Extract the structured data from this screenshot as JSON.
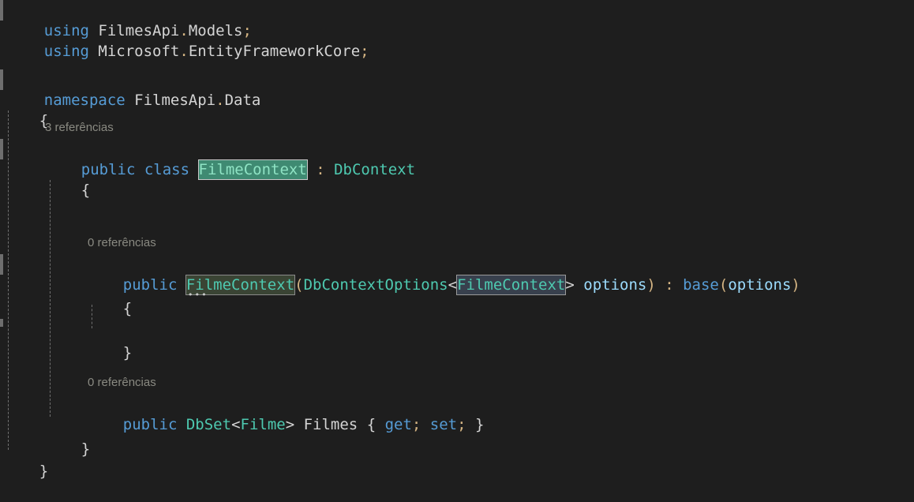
{
  "editor": {
    "background": "#1e1e1e",
    "language": "csharp",
    "font_size_px": 19,
    "line_height_px": 26
  },
  "colors": {
    "keyword": "#569cd6",
    "type": "#4ec9b0",
    "plain": "#d4d4d4",
    "variable": "#9cdcfe",
    "punctuation": "#d4b483",
    "codelens": "#8a8a82",
    "highlight_rename_bg": "#3f8a72",
    "highlight_quickaction_bg": "#3a4434",
    "highlight_occurrence_bg": "#38404d",
    "change_bar": "#6e6e6e",
    "indent_guide": "#707070"
  },
  "codelens": {
    "class_refs": "3 referências",
    "ctor_refs": "0 referências",
    "property_refs": "0 referências"
  },
  "code": {
    "line1": {
      "kw_using": "using",
      "ns": " FilmesApi",
      "dot": ".",
      "name": "Models",
      "semi": ";"
    },
    "line2": {
      "kw_using": "using",
      "ns": " Microsoft",
      "dot": ".",
      "name": "EntityFrameworkCore",
      "semi": ";"
    },
    "line4": {
      "kw_namespace": "namespace",
      "name": " FilmesApi",
      "dot": ".",
      "name2": "Data"
    },
    "line5": {
      "brace": "{"
    },
    "line7": {
      "kw_public": "public",
      "kw_class": " class",
      "space": " ",
      "classname": "FilmeContext",
      "colon": " : ",
      "base": "DbContext"
    },
    "line8": {
      "brace": "{"
    },
    "line12": {
      "kw_public": "public",
      "space": " ",
      "ctorname": "FilmeContext",
      "lparen": "(",
      "paramtype": "DbContextOptions",
      "lt": "<",
      "generic": "FilmeContext",
      "gt": ">",
      "paramname": " options",
      "rparen": ")",
      "colon": " : ",
      "kw_base": "base",
      "lparen2": "(",
      "arg": "options",
      "rparen2": ")"
    },
    "line13": {
      "brace": "{"
    },
    "line15": {
      "brace": "}"
    },
    "line18": {
      "kw_public": "public",
      "space": " ",
      "settype": "DbSet",
      "lt": "<",
      "generic": "Filme",
      "gt": ">",
      "propname": " Filmes",
      "open": " { ",
      "kw_get": "get",
      "semi1": "; ",
      "kw_set": "set",
      "semi2": "; ",
      "close": "}"
    },
    "line19": {
      "brace": "}"
    },
    "line20": {
      "brace": "}"
    }
  }
}
